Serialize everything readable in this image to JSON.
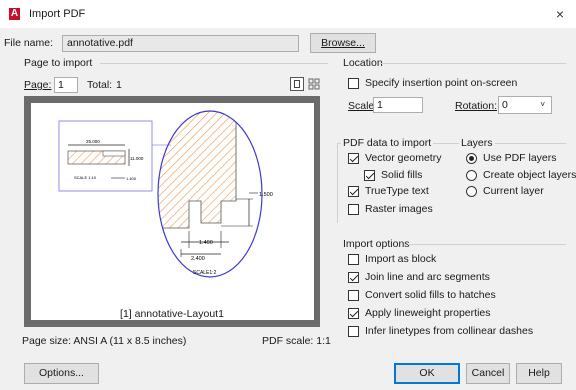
{
  "window": {
    "title": "Import PDF",
    "close_glyph": "×"
  },
  "file": {
    "label": "File name:",
    "value": "annotative.pdf",
    "browse_label": "Browse..."
  },
  "page_to_import": {
    "group_label": "Page to import",
    "page_label": "Page:",
    "page_value": "1",
    "total_label": "Total:",
    "total_value": "1",
    "preview_caption": "[1] annotative-Layout1",
    "page_size": "Page size:  ANSI A (11 x 8.5 inches)",
    "pdf_scale": "PDF scale: 1:1",
    "drawing_labels": {
      "dim_top": "25.000",
      "dim_right": "11.000",
      "dim_bottom": "1.400",
      "scale_small": "SCALE  1:10",
      "dim_large_right": "1.500",
      "dim_large_1": "1.400",
      "dim_large_2": "2.400",
      "scale_large": "SCALE1:2"
    }
  },
  "location": {
    "group_label": "Location",
    "specify_label": "Specify insertion point on-screen",
    "specify_checked": false,
    "scale_label": "Scale:",
    "scale_value": "1",
    "rotation_label": "Rotation:",
    "rotation_value": "0"
  },
  "pdf_data": {
    "group_label": "PDF data to import",
    "items": [
      {
        "label": "Vector geometry",
        "checked": true
      },
      {
        "label": "Solid fills",
        "checked": true
      },
      {
        "label": "TrueType text",
        "checked": true
      },
      {
        "label": "Raster images",
        "checked": false
      }
    ]
  },
  "layers": {
    "group_label": "Layers",
    "items": [
      {
        "label": "Use PDF layers",
        "selected": true
      },
      {
        "label": "Create object layers",
        "selected": false
      },
      {
        "label": "Current layer",
        "selected": false
      }
    ]
  },
  "import_options": {
    "group_label": "Import options",
    "items": [
      {
        "label": "Import as block",
        "checked": false
      },
      {
        "label": "Join line and arc segments",
        "checked": true
      },
      {
        "label": "Convert solid fills to hatches",
        "checked": false
      },
      {
        "label": "Apply lineweight properties",
        "checked": true
      },
      {
        "label": "Infer linetypes from collinear dashes",
        "checked": false
      }
    ]
  },
  "footer": {
    "options_label": "Options...",
    "ok_label": "OK",
    "cancel_label": "Cancel",
    "help_label": "Help"
  },
  "icons": {
    "app": "autocad-logo-icon",
    "view_single": "single-page-view-icon",
    "view_thumbnails": "thumbnail-view-icon",
    "dropdown": "chevron-down-icon"
  },
  "colors": {
    "accent": "#0078d7",
    "app_icon": "#c8102e",
    "hatch": "#e89a5a",
    "detail_circle": "#3b3bd0"
  }
}
